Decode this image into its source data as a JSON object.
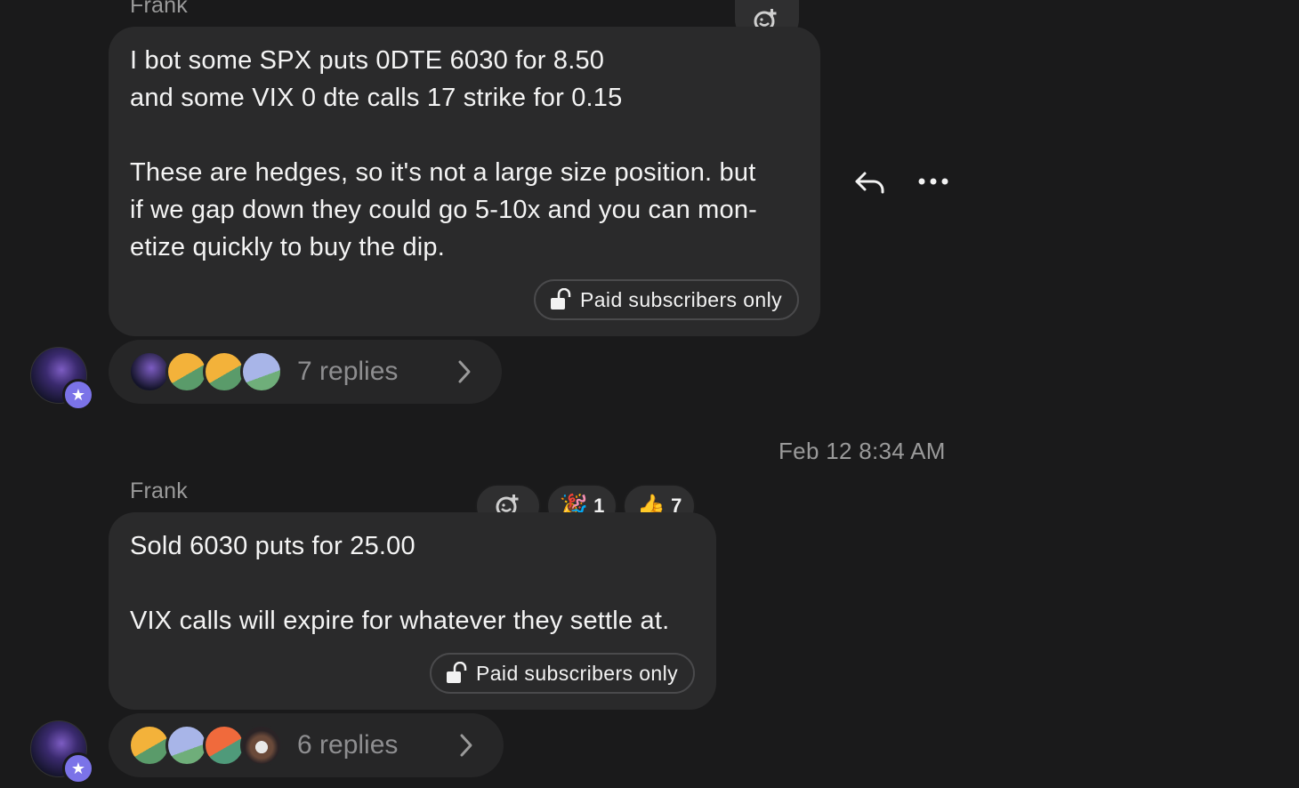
{
  "messages": [
    {
      "author": "Frank",
      "text": "I bot some SPX puts 0DTE 6030 for 8.50\nand some VIX 0 dte calls 17 strike for 0.15\n\nThese are hedges, so it's not a large size position. but\nif we gap down they could go 5-10x and you can mon-\netize quickly to buy the dip.",
      "paid_label": "Paid subscribers only",
      "replies_label": "7 replies"
    },
    {
      "timestamp": "Feb 12 8:34 AM",
      "author": "Frank",
      "text": "Sold 6030 puts for 25.00\n\nVIX calls will expire for whatever they settle at.",
      "paid_label": "Paid subscribers only",
      "reactions": [
        {
          "emoji": "🎉",
          "count": "1"
        },
        {
          "emoji": "👍",
          "count": "7"
        }
      ],
      "replies_label": "6 replies"
    }
  ],
  "colors": {
    "background": "#1a1a1b",
    "bubble": "#2a2a2b",
    "badge": "#7b73e8"
  },
  "icons": {
    "add_reaction": "emoji-plus-icon",
    "reply": "reply-arrow-icon",
    "more": "more-dots-icon",
    "lock": "unlock-icon",
    "chevron": "chevron-right-icon"
  }
}
